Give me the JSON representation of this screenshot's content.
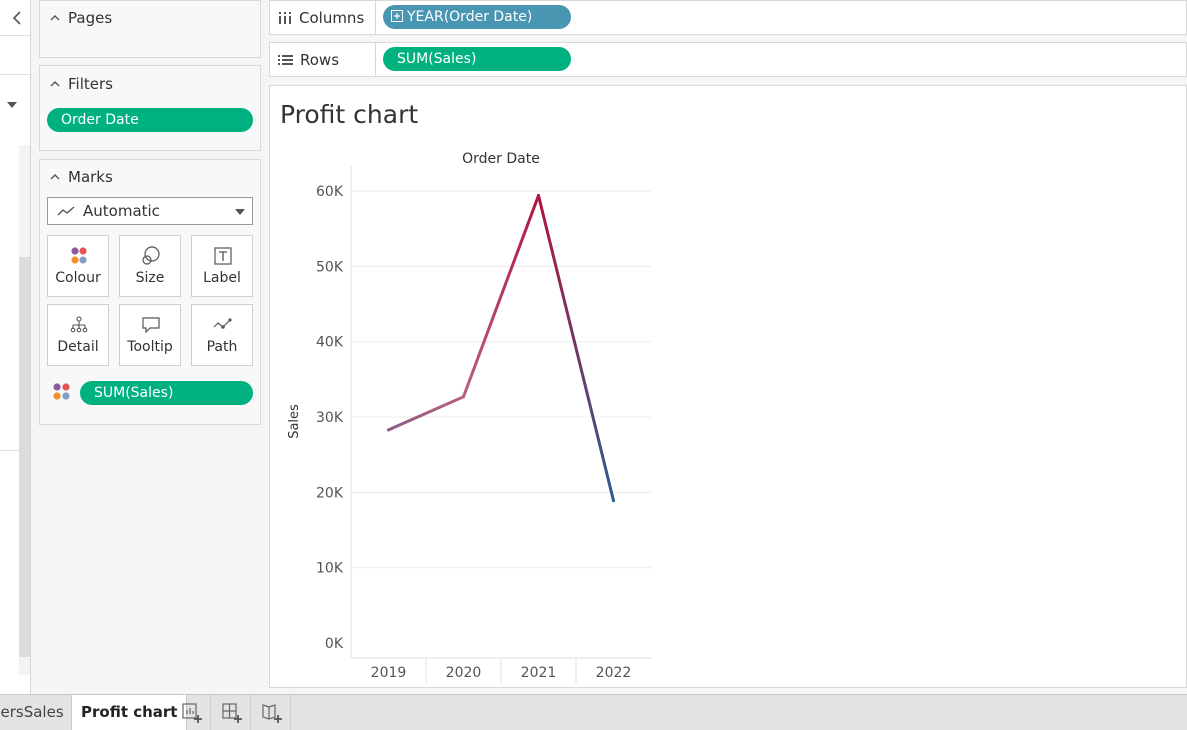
{
  "left_pane": {},
  "cards": {
    "pages": {
      "title": "Pages"
    },
    "filters": {
      "title": "Filters",
      "pills": [
        "Order Date"
      ]
    },
    "marks": {
      "title": "Marks",
      "mark_type": "Automatic",
      "buttons": [
        {
          "label": "Colour",
          "icon": "colour-icon"
        },
        {
          "label": "Size",
          "icon": "size-icon"
        },
        {
          "label": "Label",
          "icon": "label-icon"
        },
        {
          "label": "Detail",
          "icon": "detail-icon"
        },
        {
          "label": "Tooltip",
          "icon": "tooltip-icon"
        },
        {
          "label": "Path",
          "icon": "path-icon"
        }
      ],
      "colour_pill": "SUM(Sales)"
    }
  },
  "shelves": {
    "columns": {
      "label": "Columns",
      "pill": "YEAR(Order Date)",
      "pill_color": "#4996b2"
    },
    "rows": {
      "label": "Rows",
      "pill": "SUM(Sales)",
      "pill_color": "#00b180"
    }
  },
  "view": {
    "title": "Profit chart"
  },
  "chart_data": {
    "type": "line",
    "title": "",
    "header": "Order Date",
    "xlabel": "",
    "ylabel": "Sales",
    "categories": [
      "2019",
      "2020",
      "2021",
      "2022"
    ],
    "series": [
      {
        "values": [
          28300,
          32700,
          59400,
          18900
        ]
      }
    ],
    "ylim": [
      0,
      62000
    ],
    "yticks": [
      0,
      10000,
      20000,
      30000,
      40000,
      50000,
      60000
    ],
    "ytick_labels": [
      "0K",
      "10K",
      "20K",
      "30K",
      "40K",
      "50K",
      "60K"
    ],
    "colors": {
      "low": "#2e5a8f",
      "mid": "#d0607f",
      "high": "#b2143f"
    },
    "grid": true,
    "legend": "none"
  },
  "tabs": {
    "items": [
      {
        "label": "nersSales",
        "active": false
      },
      {
        "label": "Profit chart",
        "active": true
      }
    ],
    "actions": [
      "new-worksheet-icon",
      "new-dashboard-icon",
      "new-story-icon"
    ]
  }
}
